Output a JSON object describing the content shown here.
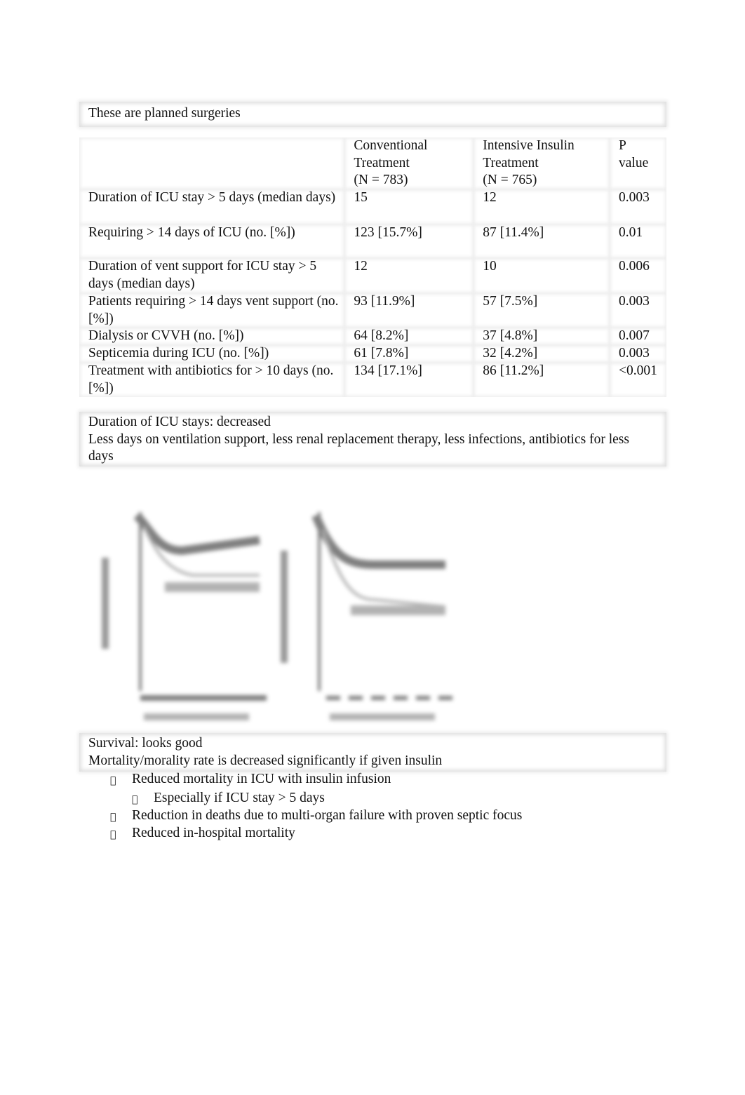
{
  "intro": "These are planned surgeries",
  "table": {
    "headers": [
      "",
      "Conventional Treatment (N = 783)",
      "Intensive Insulin Treatment (N = 765)",
      "P value"
    ],
    "header_lines": [
      [],
      [
        "Conventional",
        "Treatment",
        "(N = 783)"
      ],
      [
        "Intensive Insulin",
        "Treatment",
        "(N = 765)"
      ],
      [
        "P",
        "value"
      ]
    ],
    "rows": [
      [
        "Duration of ICU stay > 5 days (median days)",
        "15",
        "12",
        "0.003"
      ],
      [
        "Requiring > 14 days of ICU (no. [%])",
        "123 [15.7%]",
        "87 [11.4%]",
        "0.01"
      ],
      [
        "Duration of vent support for ICU stay > 5 days (median days)",
        "12",
        "10",
        "0.006"
      ],
      [
        "Patients requiring > 14 days vent support (no. [%])",
        "93 [11.9%]",
        "57 [7.5%]",
        "0.003"
      ],
      [
        "Dialysis or CVVH (no. [%])",
        "64 [8.2%]",
        "37 [4.8%]",
        "0.007"
      ],
      [
        "Septicemia during ICU (no. [%])",
        "61 [7.8%]",
        "32 [4.2%]",
        "0.003"
      ],
      [
        "Treatment with antibiotics for > 10 days (no. [%])",
        "134 [17.1%]",
        "86 [11.2%]",
        "<0.001"
      ]
    ]
  },
  "summary1": {
    "line1": "Duration of ICU stays: decreased",
    "line2": "Less days on ventilation support, less renal replacement therapy, less infections, antibiotics for less days"
  },
  "summary2": {
    "line1": "Survival: looks good",
    "line2": "Mortality/morality rate is decreased significantly if given insulin"
  },
  "bullet_glyph": "",
  "bullets": [
    {
      "level": 1,
      "text": "Reduced mortality in ICU with insulin infusion"
    },
    {
      "level": 2,
      "text": "Especially if ICU stay > 5 days"
    },
    {
      "level": 1,
      "text": "Reduction in deaths due to multi-organ failure with proven septic focus"
    },
    {
      "level": 1,
      "text": "Reduced in-hospital mortality"
    }
  ]
}
